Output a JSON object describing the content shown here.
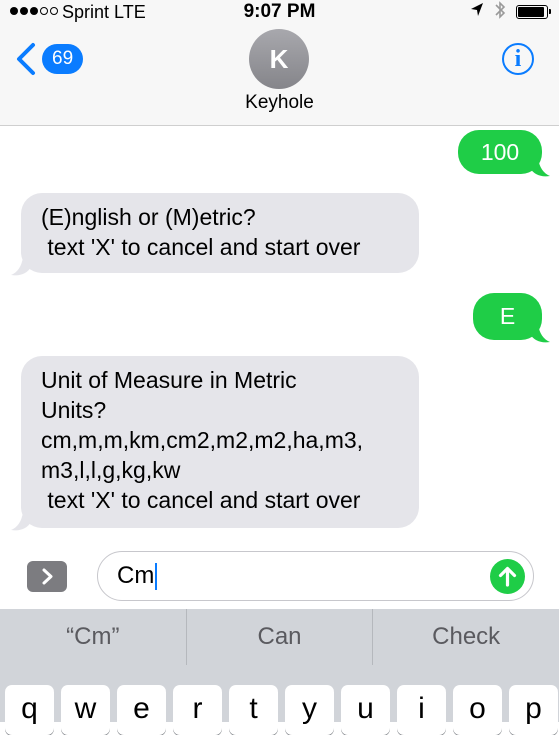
{
  "status_bar": {
    "carrier": "Sprint  LTE",
    "time": "9:07 PM",
    "signal_dots": [
      true,
      true,
      true,
      false,
      false
    ],
    "battery_level": 0.95
  },
  "header": {
    "back_count": "69",
    "avatar_initial": "K",
    "contact_name": "Keyhole",
    "info_glyph": "i"
  },
  "messages": [
    {
      "direction": "outgoing",
      "text": "100"
    },
    {
      "direction": "incoming",
      "text": "(E)nglish or (M)etric?\n text 'X' to cancel and start over"
    },
    {
      "direction": "outgoing",
      "text": "E"
    },
    {
      "direction": "incoming",
      "text": "Unit of Measure in Metric\nUnits?\ncm,m,m,km,cm2,m2,m2,ha,m3,\nm3,l,l,g,kg,kw\n text 'X' to cancel and start over"
    }
  ],
  "composer": {
    "value": "Cm"
  },
  "suggestions": [
    "“Cm”",
    "Can",
    "Check"
  ],
  "keyboard_row": [
    "q",
    "w",
    "e",
    "r",
    "t",
    "y",
    "u",
    "i",
    "o",
    "p"
  ],
  "colors": {
    "accent": "#0a7cff",
    "outgoing_bubble": "#1fcd47",
    "incoming_bubble": "#e5e5ea"
  },
  "icons": {
    "back": "chevron-left-icon",
    "info": "info-icon",
    "bluetooth": "bluetooth-icon",
    "location": "location-arrow-icon",
    "battery": "battery-icon",
    "expand": "chevron-right-icon",
    "send": "arrow-up-icon"
  }
}
